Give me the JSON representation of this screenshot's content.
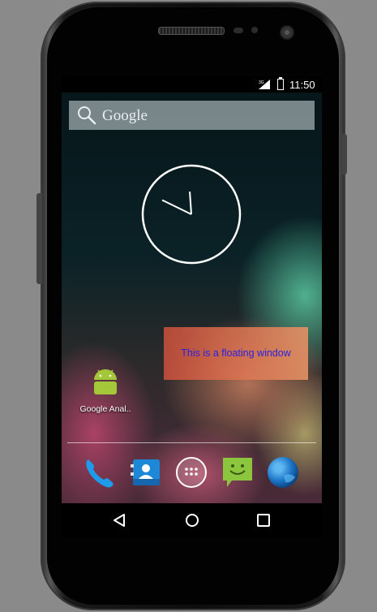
{
  "status_bar": {
    "signal": "3G",
    "time": "11:50"
  },
  "search": {
    "label": "Google"
  },
  "clock": {
    "hour_hand_deg": 296,
    "minute_hand_deg": 356
  },
  "floating_window": {
    "text": "This is a floating window"
  },
  "home_apps": [
    {
      "label": "Google Anal.."
    }
  ],
  "dock": {
    "items": [
      "phone-icon",
      "contacts-icon",
      "app-drawer-icon",
      "messaging-icon",
      "browser-icon"
    ]
  },
  "nav": {
    "items": [
      "back-icon",
      "home-icon",
      "recents-icon"
    ]
  },
  "colors": {
    "floating_text": "#2a20e0",
    "android_green": "#a4c639"
  }
}
